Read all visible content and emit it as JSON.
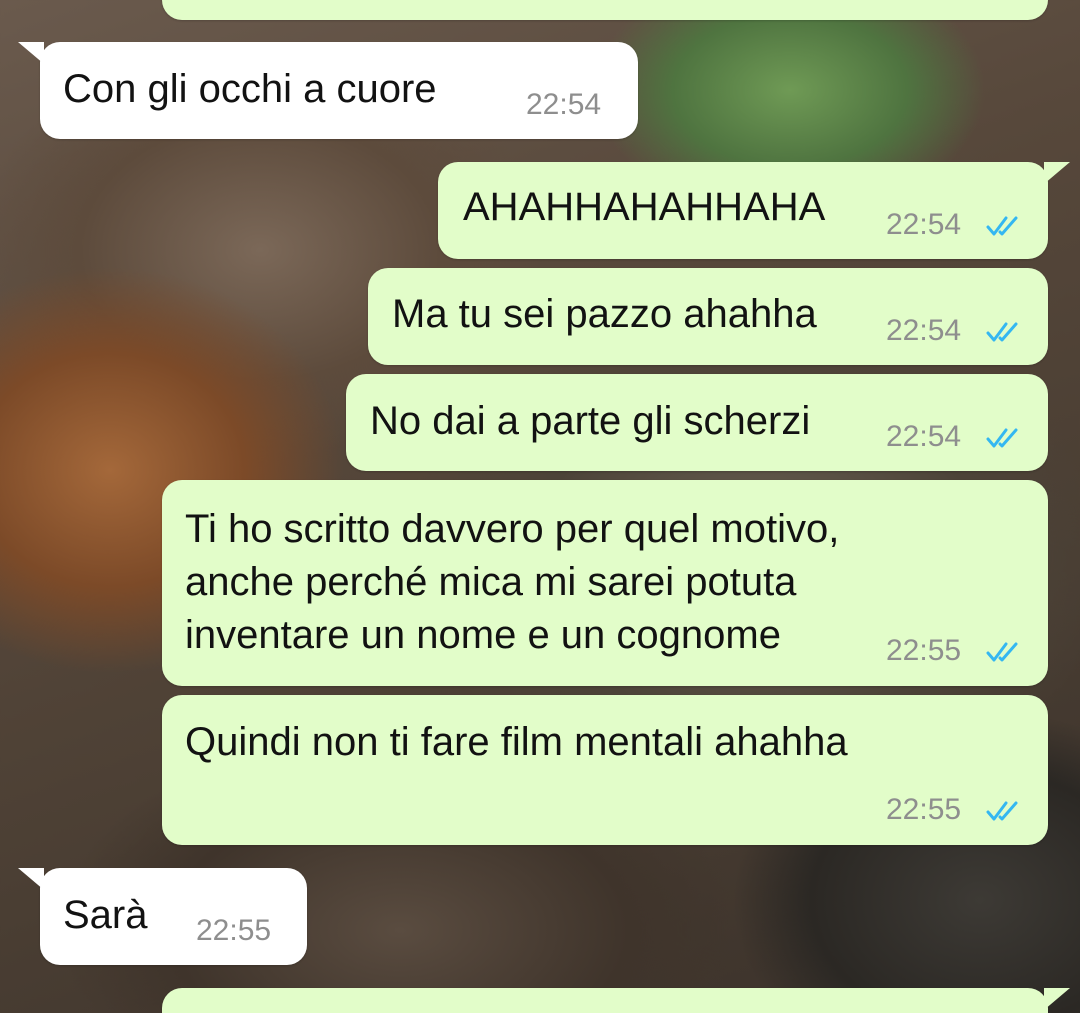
{
  "conversation": {
    "colors": {
      "incoming_bubble": "#ffffff",
      "outgoing_bubble": "#e2fdc9",
      "timestamp": "#8e8e8e",
      "read_ticks": "#34b7f1"
    },
    "messages": [
      {
        "direction": "incoming",
        "text": "Con gli occhi a cuore",
        "time": "22:54"
      },
      {
        "direction": "outgoing",
        "text": "AHAHHAHAHHAHA",
        "time": "22:54",
        "status": "read-double-tick-icon"
      },
      {
        "direction": "outgoing",
        "text": "Ma tu sei pazzo ahahha",
        "time": "22:54",
        "status": "read-double-tick-icon"
      },
      {
        "direction": "outgoing",
        "text": "No dai a parte gli scherzi",
        "time": "22:54",
        "status": "read-double-tick-icon"
      },
      {
        "direction": "outgoing",
        "lines": [
          "Ti ho scritto davvero per quel motivo,",
          "anche perché mica mi sarei potuta",
          "inventare un nome e un cognome"
        ],
        "time": "22:55",
        "status": "read-double-tick-icon"
      },
      {
        "direction": "outgoing",
        "text": "Quindi non ti fare film mentali ahahha",
        "time": "22:55",
        "status": "read-double-tick-icon"
      },
      {
        "direction": "incoming",
        "text": "Sarà",
        "time": "22:55"
      }
    ]
  }
}
